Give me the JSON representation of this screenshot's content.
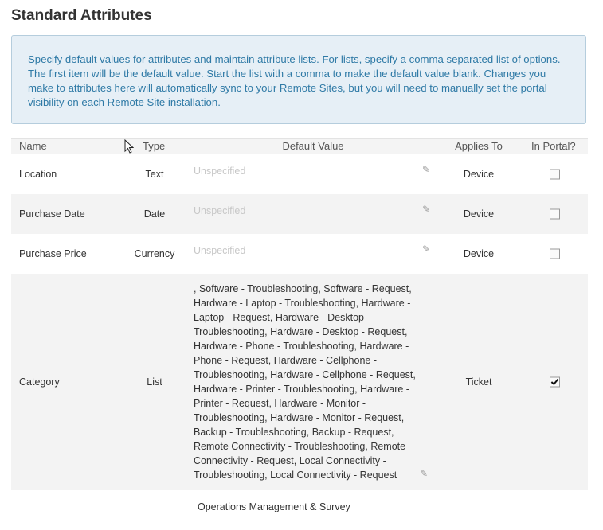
{
  "page": {
    "title": "Standard Attributes"
  },
  "info": {
    "text": "Specify default values for attributes and maintain attribute lists. For lists, specify a comma separated list of options. The first item will be the default value. Start the list with a comma to make the default value blank. Changes you make to attributes here will automatically sync to your Remote Sites, but you will need to manually set the portal visibility on each Remote Site installation."
  },
  "table": {
    "headers": {
      "name": "Name",
      "type": "Type",
      "default_value": "Default Value",
      "applies_to": "Applies To",
      "in_portal": "In Portal?"
    },
    "rows": [
      {
        "name": "Location",
        "type": "Text",
        "default_value": "Unspecified",
        "applies_to": "Device",
        "in_portal": false
      },
      {
        "name": "Purchase Date",
        "type": "Date",
        "default_value": "Unspecified",
        "applies_to": "Device",
        "in_portal": false
      },
      {
        "name": "Purchase Price",
        "type": "Currency",
        "default_value": "Unspecified",
        "applies_to": "Device",
        "in_portal": false
      },
      {
        "name": "Category",
        "type": "List",
        "default_value": ", Software - Troubleshooting, Software - Request, Hardware - Laptop - Troubleshooting, Hardware - Laptop - Request, Hardware - Desktop - Troubleshooting, Hardware - Desktop - Request, Hardware - Phone - Troubleshooting, Hardware - Phone - Request, Hardware - Cellphone - Troubleshooting, Hardware - Cellphone - Request, Hardware - Printer - Troubleshooting, Hardware - Printer - Request, Hardware - Monitor - Troubleshooting, Hardware - Monitor - Request, Backup - Troubleshooting, Backup - Request, Remote Connectivity - Troubleshooting, Remote Connectivity - Request, Local Connectivity - Troubleshooting, Local Connectivity - Request",
        "applies_to": "Ticket",
        "in_portal": true
      },
      {
        "default_value": "Operations Management & Survey"
      }
    ]
  }
}
